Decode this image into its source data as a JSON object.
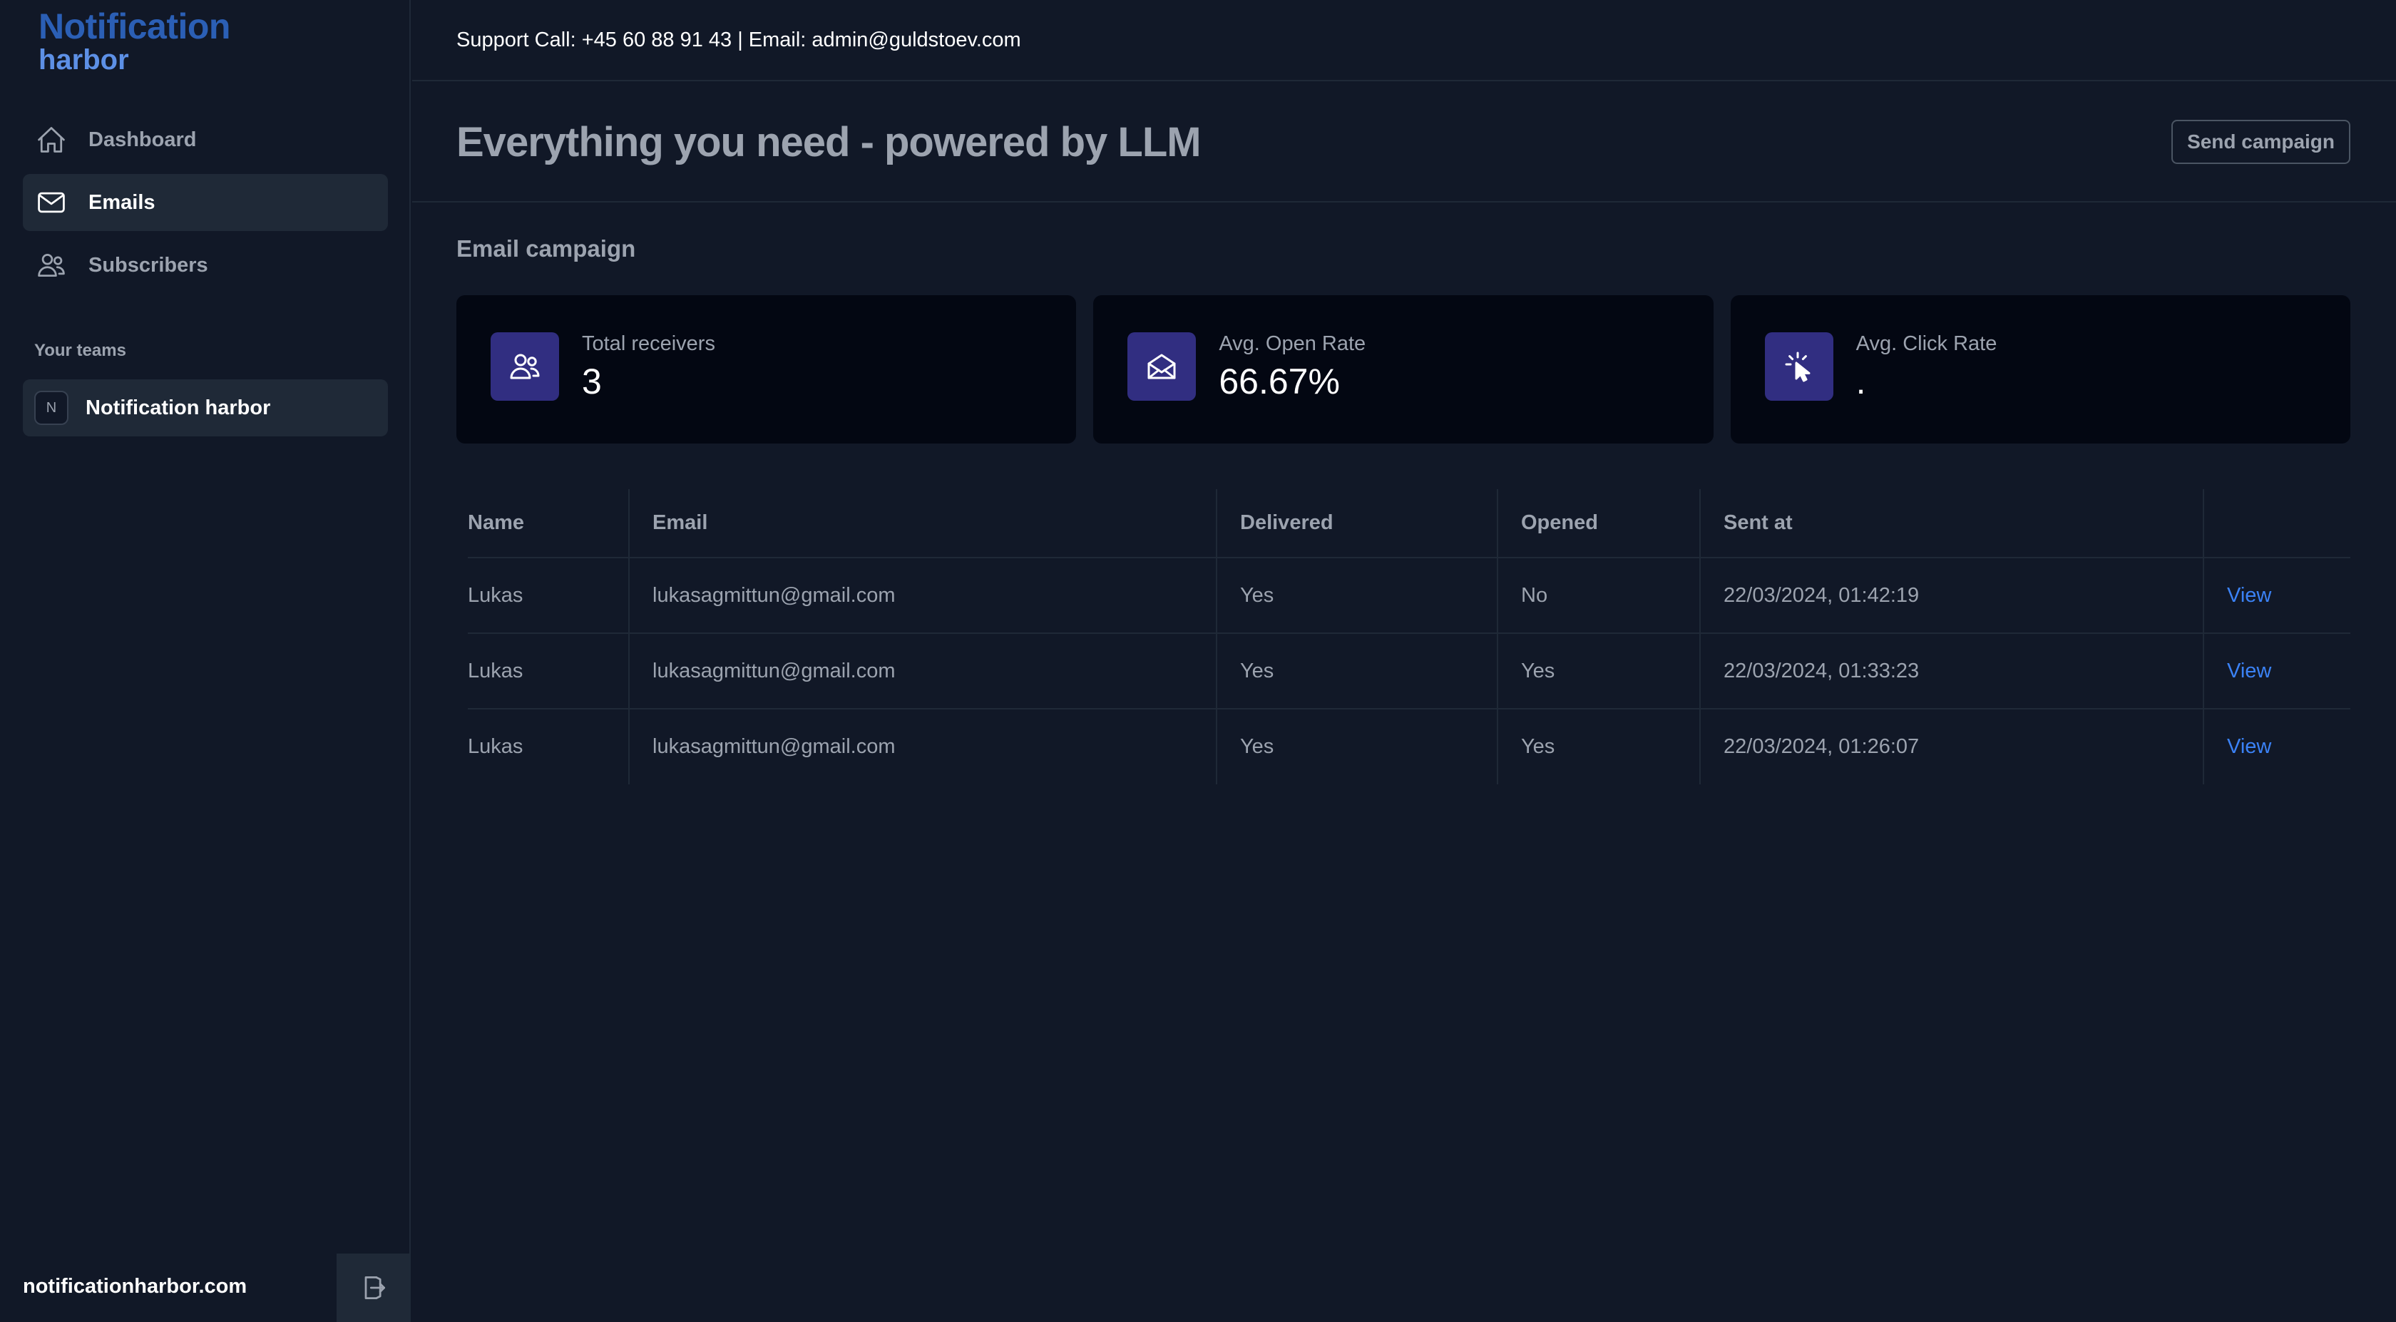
{
  "brand": {
    "line1": "Notification",
    "line2": "harbor",
    "primary": "#2b5fb5",
    "secondary": "#5d90e6"
  },
  "sidebar": {
    "items": [
      {
        "label": "Dashboard",
        "icon": "home-icon",
        "active": false
      },
      {
        "label": "Emails",
        "icon": "envelope-icon",
        "active": true
      },
      {
        "label": "Subscribers",
        "icon": "users-icon",
        "active": false
      }
    ],
    "teams_heading": "Your teams",
    "team": {
      "initial": "N",
      "name": "Notification harbor"
    },
    "footer_link": "notificationharbor.com"
  },
  "topbar": {
    "support": "Support Call: +45 60 88 91 43 | Email: admin@guldstoev.com"
  },
  "header": {
    "title": "Everything you need - powered by LLM",
    "send_button": "Send campaign"
  },
  "section_title": "Email campaign",
  "stats": [
    {
      "label": "Total receivers",
      "value": "3",
      "icon": "users-icon"
    },
    {
      "label": "Avg. Open Rate",
      "value": "66.67%",
      "icon": "envelope-open-icon"
    },
    {
      "label": "Avg. Click Rate",
      "value": ".",
      "icon": "cursor-click-icon"
    }
  ],
  "table": {
    "headers": [
      "Name",
      "Email",
      "Delivered",
      "Opened",
      "Sent at",
      ""
    ],
    "rows": [
      {
        "name": "Lukas",
        "email": "lukasagmittun@gmail.com",
        "delivered": "Yes",
        "opened": "No",
        "sent_at": "22/03/2024, 01:42:19",
        "action": "View"
      },
      {
        "name": "Lukas",
        "email": "lukasagmittun@gmail.com",
        "delivered": "Yes",
        "opened": "Yes",
        "sent_at": "22/03/2024, 01:33:23",
        "action": "View"
      },
      {
        "name": "Lukas",
        "email": "lukasagmittun@gmail.com",
        "delivered": "Yes",
        "opened": "Yes",
        "sent_at": "22/03/2024, 01:26:07",
        "action": "View"
      }
    ]
  },
  "colors": {
    "background": "#111827",
    "card": "#030712",
    "accent": "#312e81",
    "link": "#3b82f6"
  }
}
